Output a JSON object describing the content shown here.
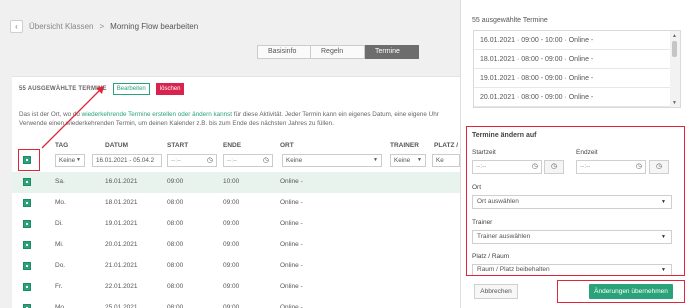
{
  "header": {
    "back_icon": "chevron-left-icon",
    "breadcrumb_parent": "Übersicht Klassen",
    "breadcrumb_sep": ">",
    "breadcrumb_current": "Morning Flow bearbeiten"
  },
  "tabs": [
    {
      "label": "Basisinfo"
    },
    {
      "label": "Regeln"
    },
    {
      "label": "Termine"
    }
  ],
  "selection": {
    "count_label": "55 AUSGEWÄHLTE TERMINE",
    "edit_label": "Bearbeiten",
    "delete_label": "löschen"
  },
  "hint": {
    "prefix": "Das ist der Ort, wo du ",
    "link": "wiederkehrende Termine erstellen oder ändern kannst",
    "suffix": " für diese Aktivität. Jeder Termin kann ein eigenes Datum, eine eigene Uhr",
    "line2": "Verwende einen wiederkehrenden Termin, um deinen Kalender z.B. bis zum Ende des nächsten Jahres zu füllen."
  },
  "table": {
    "headers": {
      "tag": "TAG",
      "datum": "DATUM",
      "start": "START",
      "ende": "ENDE",
      "ort": "ORT",
      "trainer": "TRAINER",
      "platz": "PLATZ /"
    },
    "filters": {
      "tag": "Keine",
      "datum": "16.01.2021 - 05.04.2",
      "start": "--:--",
      "ende": "--:--",
      "ort": "Keine",
      "trainer": "Keine",
      "platz": "Ke"
    },
    "rows": [
      {
        "tag": "Sa.",
        "datum": "16.01.2021",
        "start": "09:00",
        "ende": "10:00",
        "ort": "Online -"
      },
      {
        "tag": "Mo.",
        "datum": "18.01.2021",
        "start": "08:00",
        "ende": "09:00",
        "ort": "Online -"
      },
      {
        "tag": "Di.",
        "datum": "19.01.2021",
        "start": "08:00",
        "ende": "09:00",
        "ort": "Online -"
      },
      {
        "tag": "Mi.",
        "datum": "20.01.2021",
        "start": "08:00",
        "ende": "09:00",
        "ort": "Online -"
      },
      {
        "tag": "Do.",
        "datum": "21.01.2021",
        "start": "08:00",
        "ende": "09:00",
        "ort": "Online -"
      },
      {
        "tag": "Fr.",
        "datum": "22.01.2021",
        "start": "08:00",
        "ende": "09:00",
        "ort": "Online -"
      },
      {
        "tag": "Mo.",
        "datum": "25.01.2021",
        "start": "08:00",
        "ende": "09:00",
        "ort": "Online -"
      }
    ]
  },
  "panel": {
    "title": "55 ausgewählte Termine",
    "items": [
      "16.01.2021 · 09:00 - 10:00 · Online -",
      "18.01.2021 · 08:00 - 09:00 · Online -",
      "19.01.2021 · 08:00 - 09:00 · Online -",
      "20.01.2021 · 08:00 - 09:00 · Online -"
    ],
    "edit_title": "Termine ändern auf",
    "start_label": "Startzeit",
    "end_label": "Endzeit",
    "time_placeholder": "--:--",
    "clock_icon": "clock-icon",
    "ort_label": "Ort",
    "ort_value": "Ort auswählen",
    "trainer_label": "Trainer",
    "trainer_value": "Trainer auswählen",
    "platz_label": "Platz / Raum",
    "platz_value": "Raum / Platz beibehalten",
    "cancel_label": "Abbrechen",
    "apply_label": "Änderungen übernehmen"
  },
  "colors": {
    "accent": "#2aa37a",
    "danger": "#d9234f",
    "annotation": "#e0263a"
  }
}
